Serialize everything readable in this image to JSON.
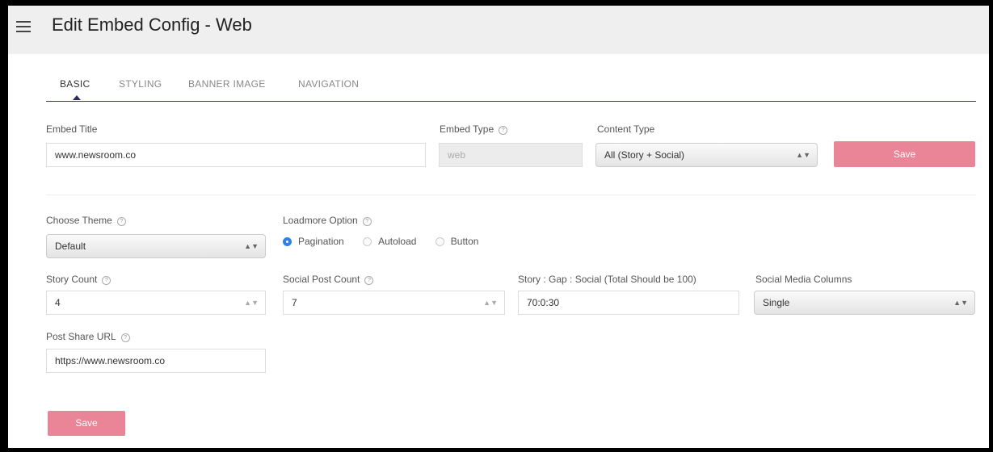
{
  "header": {
    "title": "Edit Embed Config - Web",
    "menu_icon": "hamburger-menu-icon"
  },
  "tabs": [
    {
      "label": "BASIC",
      "active": true
    },
    {
      "label": "STYLING"
    },
    {
      "label": "BANNER IMAGE"
    },
    {
      "label": "NAVIGATION"
    }
  ],
  "form": {
    "embed_title": {
      "label": "Embed Title",
      "value": "www.newsroom.co"
    },
    "embed_type": {
      "label": "Embed Type",
      "value": "web"
    },
    "content_type": {
      "label": "Content Type",
      "value": "All (Story + Social)"
    },
    "save_top": "Save",
    "theme": {
      "label": "Choose Theme",
      "value": "Default"
    },
    "loadmore": {
      "label": "Loadmore Option",
      "options": [
        "Pagination",
        "Autoload",
        "Button"
      ],
      "selected": "Pagination"
    },
    "story_count": {
      "label": "Story Count",
      "value": "4"
    },
    "social_post_count": {
      "label": "Social Post Count",
      "value": "7"
    },
    "ratio": {
      "label": "Story : Gap : Social (Total Should be 100)",
      "value": "70:0:30"
    },
    "social_columns": {
      "label": "Social Media Columns",
      "value": "Single"
    },
    "post_share_url": {
      "label": "Post Share URL",
      "value": "https://www.newsroom.co"
    },
    "save_bottom": "Save"
  },
  "colors": {
    "accent": "#ea8497",
    "radio": "#2f80ed",
    "tab_underline": "#2c2c5a"
  }
}
